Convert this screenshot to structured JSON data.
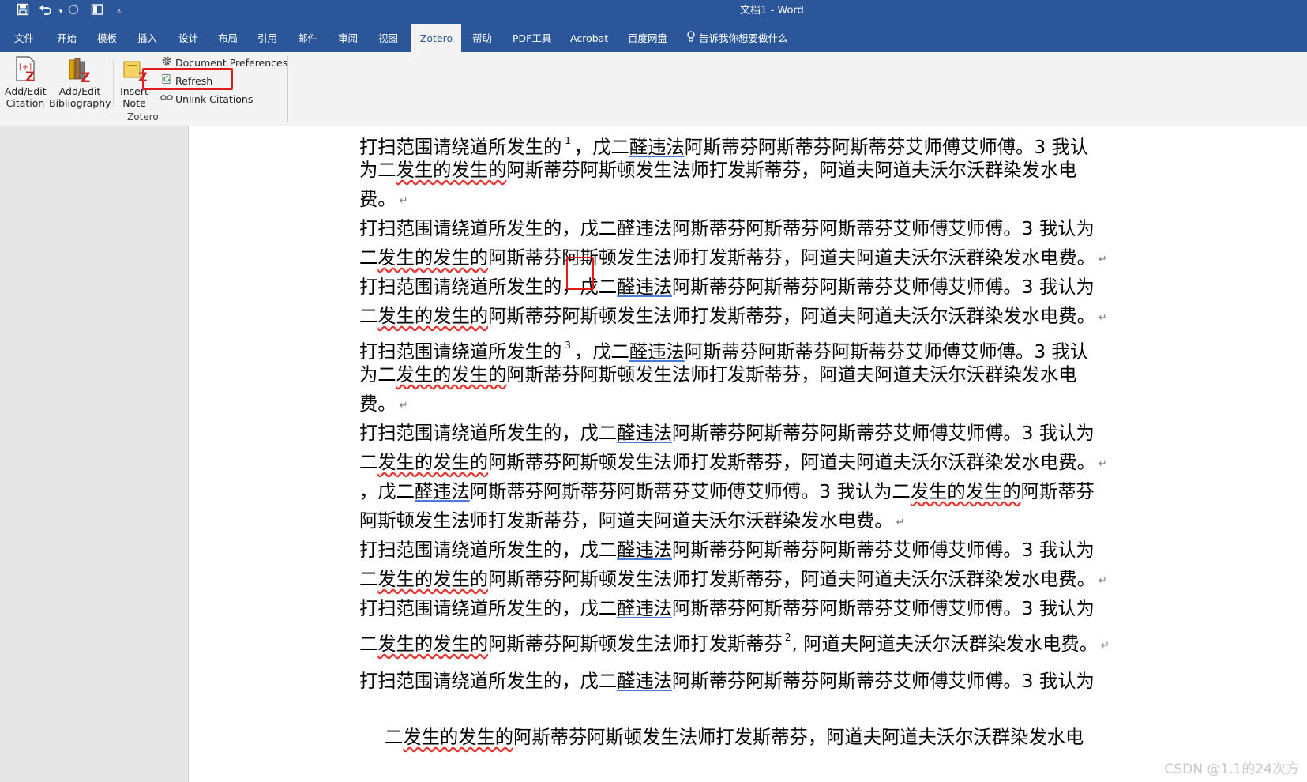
{
  "window": {
    "title": "文档1 - Word"
  },
  "quick_access": [
    {
      "icon": "save-icon"
    },
    {
      "icon": "undo-icon"
    },
    {
      "icon": "redo-icon"
    },
    {
      "icon": "layout-icon"
    },
    {
      "icon": "customize-dropdown-icon"
    }
  ],
  "tabs": [
    "文件",
    "开始",
    "模板",
    "插入",
    "设计",
    "布局",
    "引用",
    "邮件",
    "审阅",
    "视图",
    "Zotero",
    "帮助",
    "PDF工具",
    "Acrobat",
    "百度网盘"
  ],
  "active_tab": "Zotero",
  "tell_me": "告诉我你想要做什么",
  "ribbon": {
    "add_edit_citation": [
      "Add/Edit",
      "Citation"
    ],
    "add_edit_bibliography": [
      "Add/Edit",
      "Bibliography"
    ],
    "insert_note": [
      "Insert",
      "Note"
    ],
    "document_preferences": "Document Preferences",
    "refresh": "Refresh",
    "unlink_citations": "Unlink Citations",
    "group_label": "Zotero"
  },
  "doc": {
    "p1": {
      "l1a": "打扫范围请绕道所发生的",
      "l1sup": "1",
      "l1b": "，戊二",
      "l1ul": "醛违法",
      "l1c": "阿斯蒂芬阿斯蒂芬阿斯蒂芬艾师傅艾师傅。3 我认",
      "l2a": "为二",
      "l2w": "发生的发生的",
      "l2b": "阿斯蒂芬阿斯顿发生法师打发斯蒂芬，阿道夫阿道夫沃尔沃群染发水电",
      "l3": "费。"
    },
    "p2": {
      "l1": "打扫范围请绕道所发生的，戊二醛违法阿斯蒂芬阿斯蒂芬阿斯蒂芬艾师傅艾师傅。3 我认为",
      "l2a": "二",
      "l2w": "发生的发生的",
      "l2b": "阿斯蒂芬阿斯顿发生法师打发斯蒂芬，阿道夫阿道夫沃尔沃群染发水电费。"
    },
    "p3": {
      "l1a": "打扫范围请绕道所发生的，戊二",
      "l1ul": "醛违法",
      "l1b": "阿斯蒂芬阿斯蒂芬阿斯蒂芬艾师傅艾师傅。3 我认为",
      "l2a": "二",
      "l2w": "发生的发生的",
      "l2b": "阿斯蒂芬阿斯顿发生法师打发斯蒂芬，阿道夫阿道夫沃尔沃群染发水电费。"
    },
    "p4": {
      "l1a": "打扫范围请绕道所发生的",
      "l1sup": "3",
      "l1b": "，戊二",
      "l1ul": "醛违法",
      "l1c": "阿斯蒂芬阿斯蒂芬阿斯蒂芬艾师傅艾师傅。3 我认",
      "l2a": "为二",
      "l2w": "发生的发生的",
      "l2b": "阿斯蒂芬阿斯顿发生法师打发斯蒂芬，阿道夫阿道夫沃尔沃群染发水电",
      "l3": "费。"
    },
    "p5": {
      "l1a": "打扫范围请绕道所发生的，戊二",
      "l1ul": "醛违法",
      "l1b": "阿斯蒂芬阿斯蒂芬阿斯蒂芬艾师傅艾师傅。3 我认为",
      "l2a": "二",
      "l2w": "发生的发生的",
      "l2b": "阿斯蒂芬阿斯顿发生法师打发斯蒂芬，阿道夫阿道夫沃尔沃群染发水电费。"
    },
    "p6": {
      "l1a": "，戊二",
      "l1ul": "醛违法",
      "l1b": "阿斯蒂芬阿斯蒂芬阿斯蒂芬艾师傅艾师傅。3 我认为二",
      "l1w": "发生的发生的",
      "l1c": "阿斯蒂芬",
      "l2": "阿斯顿发生法师打发斯蒂芬，阿道夫阿道夫沃尔沃群染发水电费。"
    },
    "p7": {
      "l1a": "打扫范围请绕道所发生的，戊二",
      "l1ul": "醛违法",
      "l1b": "阿斯蒂芬阿斯蒂芬阿斯蒂芬艾师傅艾师傅。3 我认为",
      "l2a": "二",
      "l2w": "发生的发生的",
      "l2b": "阿斯蒂芬阿斯顿发生法师打发斯蒂芬，阿道夫阿道夫沃尔沃群染发水电费。"
    },
    "p8": {
      "l1a": "打扫范围请绕道所发生的，戊二",
      "l1ul": "醛违法",
      "l1b": "阿斯蒂芬阿斯蒂芬阿斯蒂芬艾师傅艾师傅。3 我认为",
      "l2a": "二",
      "l2w": "发生的发生的",
      "l2b": "阿斯蒂芬阿斯顿发生法师打发斯蒂芬",
      "l2sup": "2",
      "l2c": ", 阿道夫阿道夫沃尔沃群染发水电费。"
    },
    "p9": {
      "l1a": "打扫范围请绕道所发生的，戊二",
      "l1ul": "醛违法",
      "l1b": "阿斯蒂芬阿斯蒂芬阿斯蒂芬艾师傅艾师傅。3 我认为"
    },
    "p10": {
      "l1a": "二",
      "l1w": "发生的发生的",
      "l1b": "阿斯蒂芬阿斯顿发生法师打发斯蒂芬，阿道夫阿道夫沃尔沃群染发水电"
    },
    "paragraph_mark": "↵"
  },
  "watermark": "CSDN @1.1的24次方",
  "colors": {
    "titlebar": "#2b579a",
    "highlight": "#e01b1b"
  }
}
